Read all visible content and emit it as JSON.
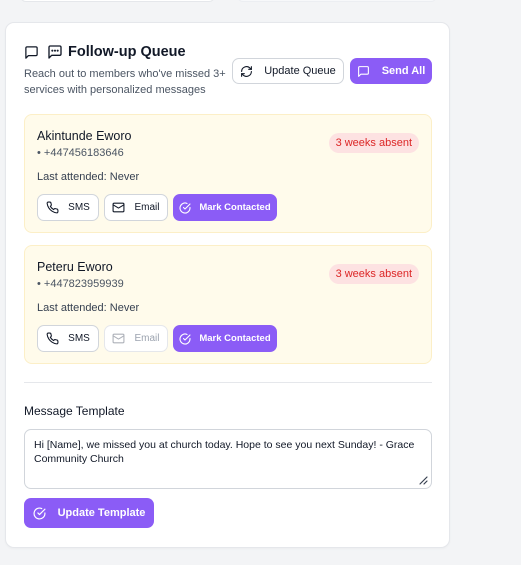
{
  "header": {
    "title": "Follow-up Queue",
    "subtitle": "Reach out to members who've missed 3+ services with personalized messages",
    "update_queue_label": "Update Queue",
    "send_all_label": "Send All"
  },
  "members": [
    {
      "name": "Akintunde Eworo",
      "phone": "• +447456183646",
      "badge": "3 weeks absent",
      "last_attended": "Last attended: Never",
      "sms_label": "SMS",
      "email_label": "Email",
      "email_enabled": true,
      "mark_label": "Mark Contacted"
    },
    {
      "name": "Peteru Eworo",
      "phone": "• +447823959939",
      "badge": "3 weeks absent",
      "last_attended": "Last attended: Never",
      "sms_label": "SMS",
      "email_label": "Email",
      "email_enabled": false,
      "mark_label": "Mark Contacted"
    }
  ],
  "template": {
    "label": "Message Template",
    "value": "Hi [Name], we missed you at church today. Hope to see you next Sunday! - Grace Community Church",
    "update_label": "Update Template"
  },
  "colors": {
    "accent": "#8b5cf6",
    "card_bg": "#fffbeb",
    "badge_bg": "#fde2e2",
    "badge_text": "#dc2626"
  },
  "icons": {
    "title_1": "message-square-icon",
    "title_2": "message-dots-icon",
    "update_queue": "refresh-icon",
    "send_all": "message-square-icon",
    "sms": "phone-icon",
    "email": "mail-icon",
    "mark": "check-circle-icon",
    "update_template": "check-circle-icon"
  }
}
